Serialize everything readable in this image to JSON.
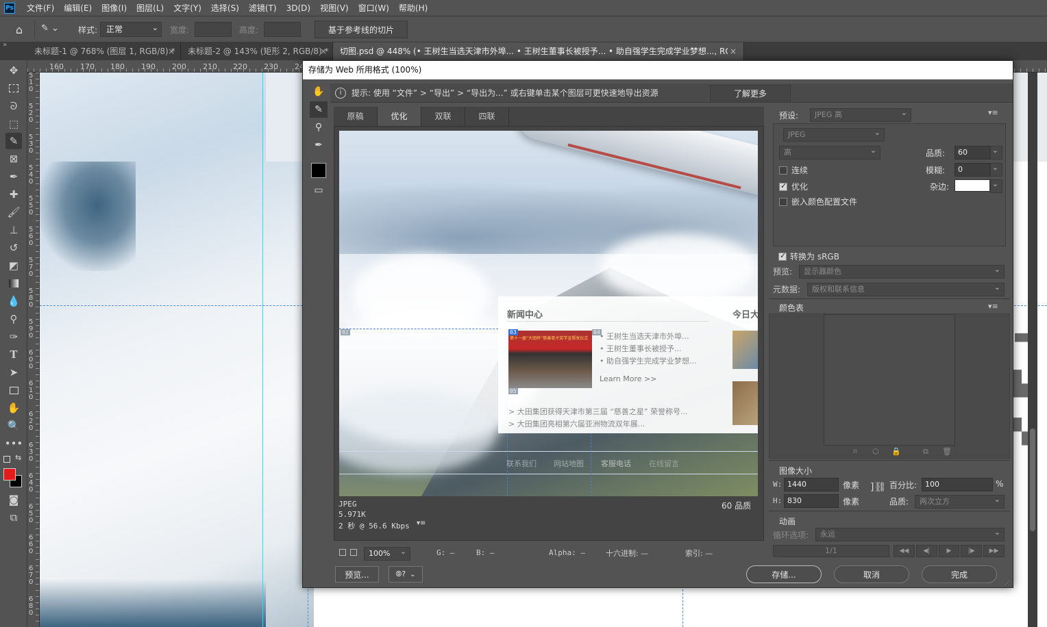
{
  "menubar": {
    "logo": "Ps",
    "items": [
      "文件(F)",
      "编辑(E)",
      "图像(I)",
      "图层(L)",
      "文字(Y)",
      "选择(S)",
      "滤镜(T)",
      "3D(D)",
      "视图(V)",
      "窗口(W)",
      "帮助(H)"
    ]
  },
  "options": {
    "style_label": "样式:",
    "style_value": "正常",
    "width_label": "宽度:",
    "height_label": "高度:",
    "slice_button": "基于参考线的切片"
  },
  "tabs": [
    {
      "label": "未标题-1 @ 768% (图层 1, RGB/8) *"
    },
    {
      "label": "未标题-2 @ 143% (矩形 2, RGB/8) *"
    },
    {
      "label": "切图.psd @ 448% (• 王树生当选天津市外埠... • 王树生董事长被授予... • 助自强学生完成学业梦想..., RGB/8) *"
    }
  ],
  "ruler": {
    "top": [
      "160",
      "170",
      "180",
      "190",
      "200",
      "210",
      "220",
      "230",
      "240"
    ],
    "left": [
      "5 1 0",
      "5 2 0",
      "5 3 0",
      "5 4 0",
      "5 5 0",
      "5 6 0",
      "5 7 0",
      "5 8 0",
      "5 9 0",
      "6 0 0",
      "6 1 0",
      "6 2 0",
      "6 3 0",
      "6 4 0",
      "6 5 0",
      "6 6 0",
      "6 7 0",
      "6 8 0"
    ]
  },
  "dialog": {
    "title": "存储为 Web 所用格式 (100%)",
    "hint": "提示:  使用 “文件” > “导出” > “导出为...” 或右键单击某个图层可更快速地导出资源",
    "learn_more": "了解更多",
    "view_tabs": [
      "原稿",
      "优化",
      "双联",
      "四联"
    ],
    "active_view_tab": "优化",
    "preview": {
      "news_title": "新闻中心",
      "news_title2": "今日大",
      "slice_ids": [
        "02",
        "03",
        "04",
        "05"
      ],
      "photo_banner": "第十一届“大田杯”慈善育才奖学金颁发仪式",
      "headlines": [
        "王树生当选天津市外埠...",
        "王树生董事长被授予...",
        "助自强学生完成学业梦想..."
      ],
      "learn_more_link": "Learn More >>",
      "news_items": [
        "大田集团获得天津市第三届 “慈善之星” 荣誉称号...",
        "大田集团亮相第六届亚洲物流双年展..."
      ],
      "footer_links": [
        "联系我们",
        "网站地图",
        "客服电话",
        "在线留言"
      ]
    },
    "preview_info": {
      "format": "JPEG",
      "size": "5.971K",
      "time": "2 秒 @ 56.6 Kbps",
      "quality": "60 品质"
    },
    "bottom_bar": {
      "zoom": "100%",
      "g": "G: —",
      "b": "B: —",
      "alpha": "Alpha: —",
      "hex": "十六进制: —",
      "index": "索引: —"
    },
    "buttons": {
      "preview": "预览...",
      "save": "存储...",
      "cancel": "取消",
      "done": "完成"
    },
    "settings": {
      "preset_label": "预设:",
      "preset_value": "JPEG 高",
      "format_value": "JPEG",
      "quality_level": "高",
      "quality_label": "品质:",
      "quality_value": "60",
      "blur_label": "模糊:",
      "blur_value": "0",
      "matte_label": "杂边:",
      "progressive_label": "连续",
      "progressive_checked": false,
      "optimized_label": "优化",
      "optimized_checked": true,
      "embed_profile_label": "嵌入颜色配置文件",
      "embed_profile_checked": false,
      "convert_srgb_label": "转换为 sRGB",
      "convert_srgb_checked": true,
      "preview_label": "预览:",
      "preview_value": "显示器颜色",
      "metadata_label": "元数据:",
      "metadata_value": "版权和联系信息"
    },
    "color_table": {
      "title": "颜色表"
    },
    "image_size": {
      "title": "图像大小",
      "w_label": "W:",
      "w_value": "1440",
      "h_label": "H:",
      "h_value": "830",
      "unit": "像素",
      "percent_label": "百分比:",
      "percent_value": "100",
      "percent_unit": "%",
      "quality_label": "品质:",
      "quality_value": "两次立方"
    },
    "animation": {
      "title": "动画",
      "loop_label": "循环选项:",
      "loop_value": "永远",
      "frame": "1/1"
    }
  },
  "colors": {
    "foreground": "#e31b1b",
    "background": "#000000",
    "guide": "#3ad4f0"
  }
}
